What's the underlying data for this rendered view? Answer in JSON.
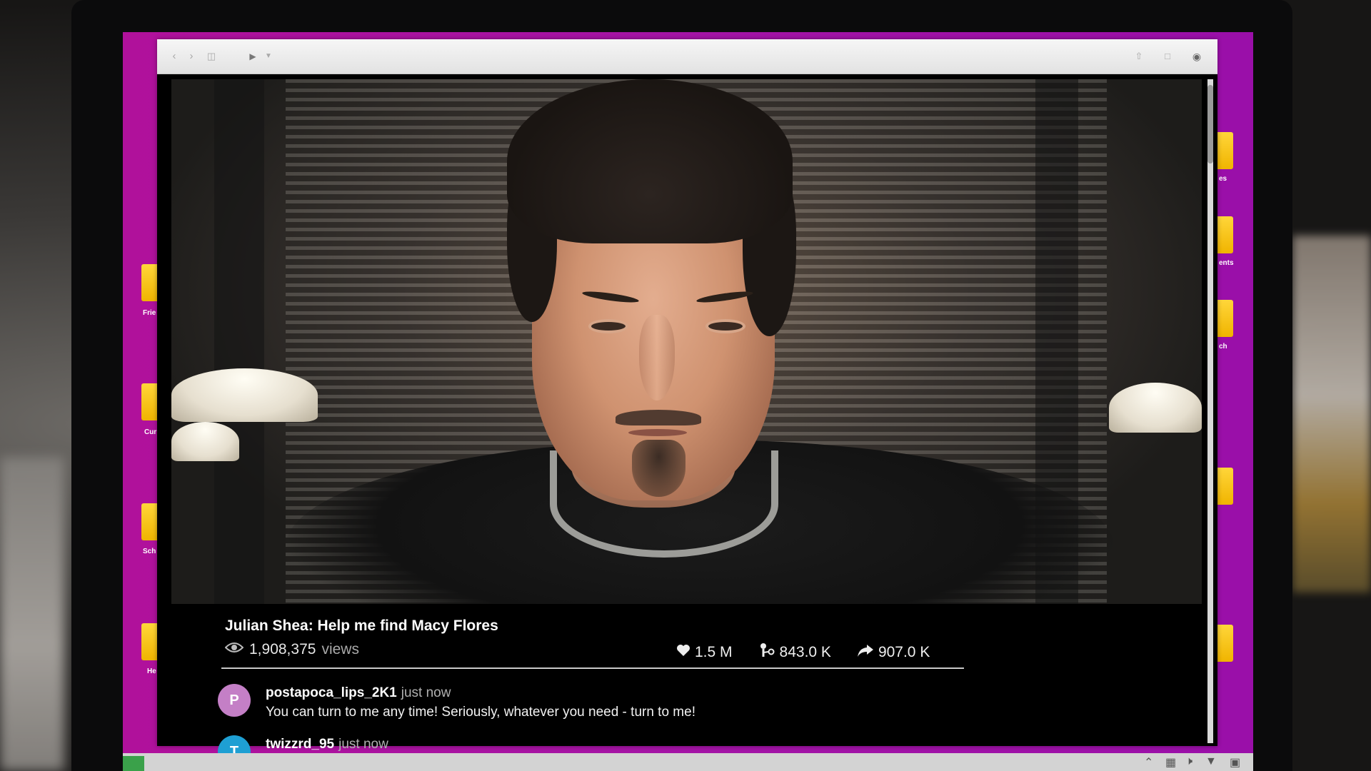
{
  "video": {
    "title": "Julian Shea: Help me find Macy Flores",
    "views_count": "1,908,375",
    "views_label": "views",
    "likes": "1.5 M",
    "connections": "843.0 K",
    "shares": "907.0 K"
  },
  "comments": [
    {
      "avatar_letter": "P",
      "avatar_color": "#c47fc6",
      "user": "postapoca_lips_2K1",
      "time": "just now",
      "text": "You can turn to me any time! Seriously, whatever you need - turn to me!"
    },
    {
      "avatar_letter": "T",
      "avatar_color": "#1e9fd3",
      "user": "twizzrd_95",
      "time": "just now",
      "text": ""
    }
  ],
  "desktop": {
    "left_icon_labels": [
      "Frie",
      "Cur",
      "Sch",
      "He"
    ],
    "right_icon_labels": [
      "es",
      "ents",
      "ch"
    ]
  },
  "colors": {
    "desktop_bg": "#a414a6",
    "browser_toolbar": "#e8e8e8"
  }
}
